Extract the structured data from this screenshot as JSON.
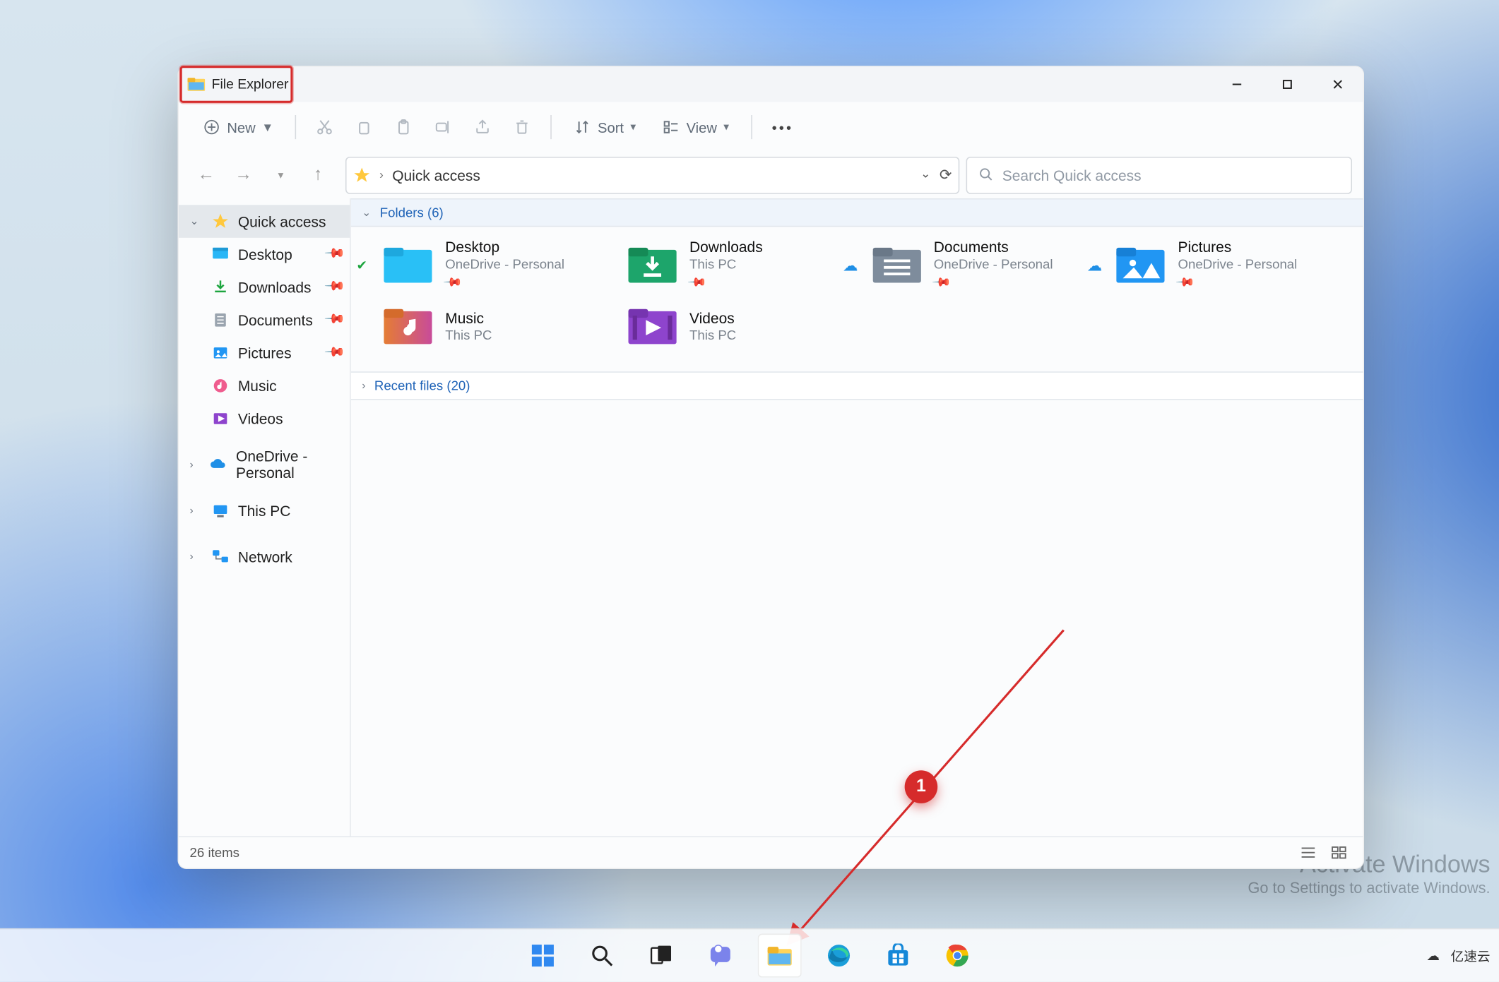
{
  "window": {
    "title": "File Explorer"
  },
  "annotation": {
    "badge": "1"
  },
  "toolbar": {
    "new_label": "New",
    "sort_label": "Sort",
    "view_label": "View"
  },
  "address": {
    "location": "Quick access"
  },
  "search": {
    "placeholder": "Search Quick access"
  },
  "sidebar": {
    "items": [
      {
        "icon": "star",
        "label": "Quick access",
        "expanded": true,
        "pinned": false,
        "selected": true
      },
      {
        "icon": "desktop",
        "label": "Desktop",
        "indent": true,
        "pinned": true
      },
      {
        "icon": "download",
        "label": "Downloads",
        "indent": true,
        "pinned": true
      },
      {
        "icon": "doc",
        "label": "Documents",
        "indent": true,
        "pinned": true
      },
      {
        "icon": "pic",
        "label": "Pictures",
        "indent": true,
        "pinned": true
      },
      {
        "icon": "music",
        "label": "Music",
        "indent": true,
        "pinned": false
      },
      {
        "icon": "video",
        "label": "Videos",
        "indent": true,
        "pinned": false
      },
      {
        "icon": "cloud",
        "label": "OneDrive - Personal",
        "expander": true
      },
      {
        "icon": "pc",
        "label": "This PC",
        "expander": true
      },
      {
        "icon": "net",
        "label": "Network",
        "expander": true
      }
    ]
  },
  "groups": {
    "folders_header": "Folders (6)",
    "recent_header": "Recent files (20)"
  },
  "folders": [
    {
      "icon": "desktop-big",
      "name": "Desktop",
      "sub": "OneDrive - Personal",
      "status": "sync"
    },
    {
      "icon": "download-big",
      "name": "Downloads",
      "sub": "This PC",
      "status": ""
    },
    {
      "icon": "doc-big",
      "name": "Documents",
      "sub": "OneDrive - Personal",
      "status": "cloud"
    },
    {
      "icon": "pic-big",
      "name": "Pictures",
      "sub": "OneDrive - Personal",
      "status": "cloud"
    },
    {
      "icon": "music-big",
      "name": "Music",
      "sub": "This PC",
      "status": ""
    },
    {
      "icon": "video-big",
      "name": "Videos",
      "sub": "This PC",
      "status": ""
    }
  ],
  "status": {
    "text": "26 items"
  },
  "watermark": {
    "line1": "Activate Windows",
    "line2": "Go to Settings to activate Windows."
  },
  "tray": {
    "brand": "亿速云"
  }
}
